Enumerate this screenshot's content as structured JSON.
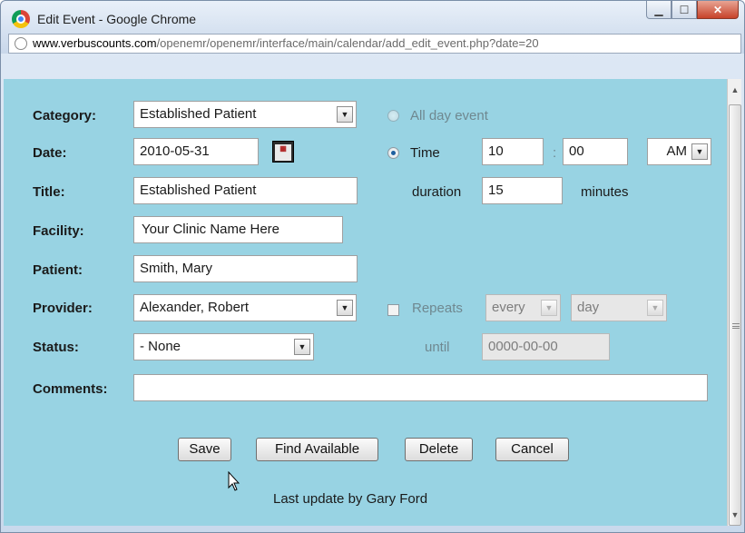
{
  "window": {
    "title": "Edit Event - Google Chrome",
    "url_host": "www.verbuscounts.com",
    "url_path": "/openemr/openemr/interface/main/calendar/add_edit_event.php?date=20"
  },
  "form": {
    "category": {
      "label": "Category:",
      "value": "Established Patient"
    },
    "all_day": {
      "label": "All day event"
    },
    "date": {
      "label": "Date:",
      "value": "2010-05-31"
    },
    "time": {
      "label": "Time",
      "hour": "10",
      "separator": ":",
      "minute": "00",
      "ampm": "AM"
    },
    "title": {
      "label": "Title:",
      "value": "Established Patient"
    },
    "duration": {
      "label": "duration",
      "value": "15",
      "unit": "minutes"
    },
    "facility": {
      "label": "Facility:",
      "value": "Your Clinic Name Here"
    },
    "patient": {
      "label": "Patient:",
      "value": "Smith, Mary"
    },
    "provider": {
      "label": "Provider:",
      "value": "Alexander, Robert"
    },
    "repeats": {
      "label": "Repeats",
      "every": "every",
      "unit": "day"
    },
    "status": {
      "label": "Status:",
      "value": "- None"
    },
    "until": {
      "label": "until",
      "value": "0000-00-00"
    },
    "comments": {
      "label": "Comments:",
      "value": ""
    }
  },
  "buttons": {
    "save": "Save",
    "find_available": "Find Available",
    "delete": "Delete",
    "cancel": "Cancel"
  },
  "footer": {
    "last_update": "Last update by Gary Ford"
  },
  "icons": {
    "browser": "chrome-logo-icon",
    "page": "globe-icon",
    "calendar": "calendar-icon",
    "cursor": "mouse-pointer-icon"
  }
}
